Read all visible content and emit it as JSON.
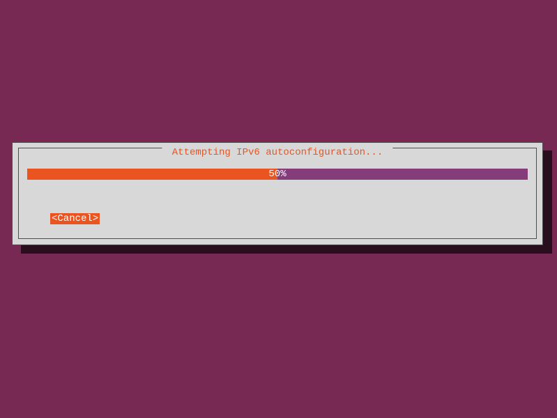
{
  "dialog": {
    "title": " Attempting IPv6 autoconfiguration... ",
    "progress": {
      "percent": 50,
      "label": "50%"
    },
    "cancel_label": "<Cancel>"
  },
  "colors": {
    "background": "#772953",
    "dialog_bg": "#d8d8d8",
    "accent": "#e95420",
    "progress_bg": "#843c7b"
  }
}
